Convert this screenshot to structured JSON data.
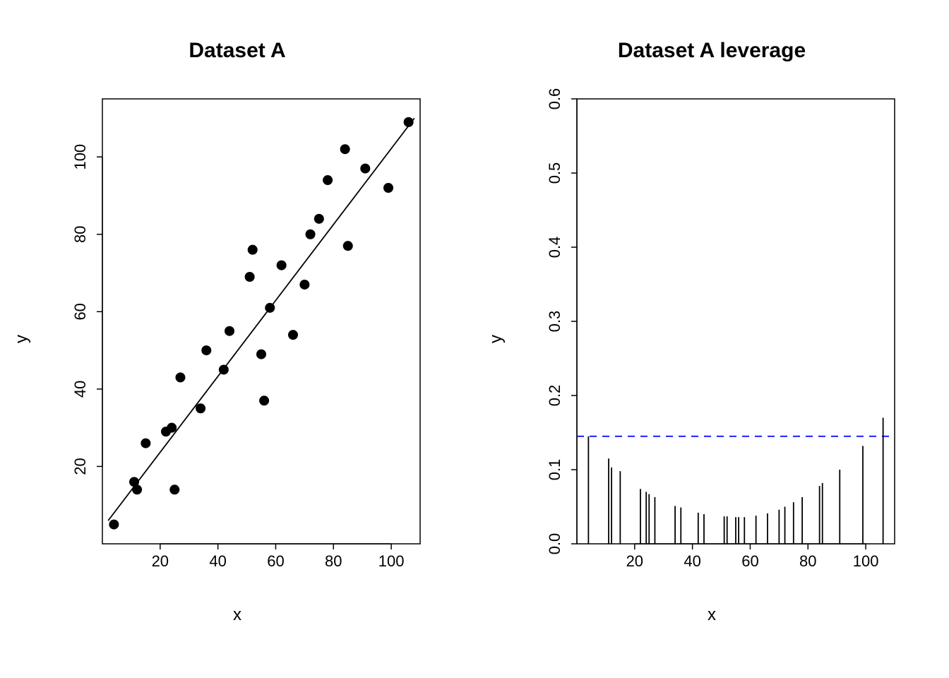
{
  "chart_data": [
    {
      "type": "scatter",
      "title": "Dataset A",
      "xlabel": "x",
      "ylabel": "y",
      "xlim": [
        0,
        110
      ],
      "ylim": [
        0,
        115
      ],
      "xticks": [
        20,
        40,
        60,
        80,
        100
      ],
      "yticks": [
        20,
        40,
        60,
        80,
        100
      ],
      "points": [
        {
          "x": 4,
          "y": 5
        },
        {
          "x": 11,
          "y": 16
        },
        {
          "x": 12,
          "y": 14
        },
        {
          "x": 15,
          "y": 26
        },
        {
          "x": 22,
          "y": 29
        },
        {
          "x": 24,
          "y": 30
        },
        {
          "x": 25,
          "y": 14
        },
        {
          "x": 27,
          "y": 43
        },
        {
          "x": 34,
          "y": 35
        },
        {
          "x": 36,
          "y": 50
        },
        {
          "x": 42,
          "y": 45
        },
        {
          "x": 44,
          "y": 55
        },
        {
          "x": 51,
          "y": 69
        },
        {
          "x": 52,
          "y": 76
        },
        {
          "x": 55,
          "y": 49
        },
        {
          "x": 56,
          "y": 37
        },
        {
          "x": 58,
          "y": 61
        },
        {
          "x": 62,
          "y": 72
        },
        {
          "x": 66,
          "y": 54
        },
        {
          "x": 70,
          "y": 67
        },
        {
          "x": 72,
          "y": 80
        },
        {
          "x": 75,
          "y": 84
        },
        {
          "x": 78,
          "y": 94
        },
        {
          "x": 84,
          "y": 102
        },
        {
          "x": 85,
          "y": 77
        },
        {
          "x": 91,
          "y": 97
        },
        {
          "x": 99,
          "y": 92
        },
        {
          "x": 106,
          "y": 109
        }
      ],
      "fit_line": {
        "x1": 2,
        "y1": 6,
        "x2": 108,
        "y2": 110
      }
    },
    {
      "type": "leverage",
      "title": "Dataset A leverage",
      "xlabel": "x",
      "ylabel": "y",
      "xlim": [
        0,
        110
      ],
      "ylim": [
        0.0,
        0.6
      ],
      "xticks": [
        20,
        40,
        60,
        80,
        100
      ],
      "yticks": [
        0.0,
        0.1,
        0.2,
        0.3,
        0.4,
        0.5,
        0.6
      ],
      "threshold": 0.145,
      "bars": [
        {
          "x": 4,
          "h": 0.145
        },
        {
          "x": 11,
          "h": 0.115
        },
        {
          "x": 12,
          "h": 0.103
        },
        {
          "x": 15,
          "h": 0.098
        },
        {
          "x": 22,
          "h": 0.074
        },
        {
          "x": 24,
          "h": 0.07
        },
        {
          "x": 25,
          "h": 0.067
        },
        {
          "x": 27,
          "h": 0.063
        },
        {
          "x": 34,
          "h": 0.051
        },
        {
          "x": 36,
          "h": 0.049
        },
        {
          "x": 42,
          "h": 0.042
        },
        {
          "x": 44,
          "h": 0.04
        },
        {
          "x": 51,
          "h": 0.037
        },
        {
          "x": 52,
          "h": 0.037
        },
        {
          "x": 55,
          "h": 0.036
        },
        {
          "x": 56,
          "h": 0.036
        },
        {
          "x": 58,
          "h": 0.036
        },
        {
          "x": 62,
          "h": 0.038
        },
        {
          "x": 66,
          "h": 0.041
        },
        {
          "x": 70,
          "h": 0.046
        },
        {
          "x": 72,
          "h": 0.05
        },
        {
          "x": 75,
          "h": 0.056
        },
        {
          "x": 78,
          "h": 0.063
        },
        {
          "x": 84,
          "h": 0.078
        },
        {
          "x": 85,
          "h": 0.082
        },
        {
          "x": 91,
          "h": 0.1
        },
        {
          "x": 99,
          "h": 0.132
        },
        {
          "x": 106,
          "h": 0.17
        }
      ]
    }
  ]
}
